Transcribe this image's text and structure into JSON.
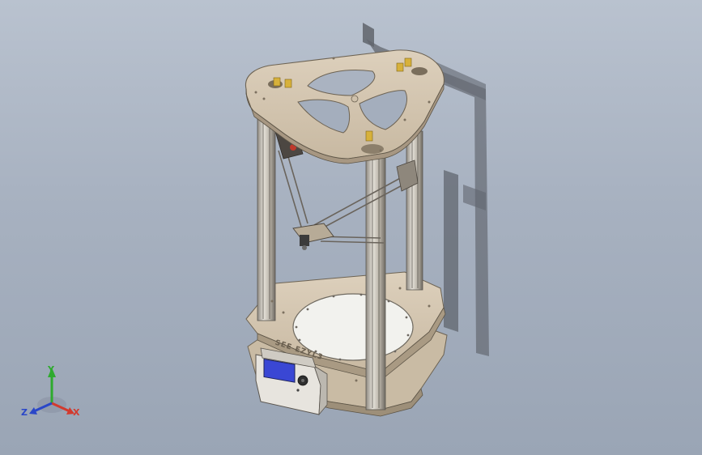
{
  "viewport": {
    "background_top": "#b9c2cf",
    "background_bottom": "#9aa5b5",
    "plate_color": "#d4c6b1",
    "frame_color": "#c9c2b6",
    "bed_color": "#f3f3ef"
  },
  "model": {
    "base_label": "SEE EZYL3"
  },
  "triad": {
    "x_label": "X",
    "y_label": "Y",
    "z_label": "Z"
  }
}
